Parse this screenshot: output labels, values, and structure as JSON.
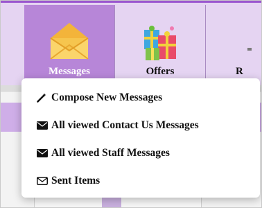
{
  "nav": {
    "tiles": [
      {
        "label": "Messages",
        "icon": "envelope-icon"
      },
      {
        "label": "Offers",
        "icon": "gift-boxes-icon"
      },
      {
        "label": "R",
        "icon": "cut-off-icon"
      }
    ]
  },
  "dropdown": {
    "items": [
      {
        "label": "Compose New Messages",
        "icon": "magic-wand-icon"
      },
      {
        "label": "All viewed Contact Us Messages",
        "icon": "envelope-solid-icon"
      },
      {
        "label": "All viewed Staff Messages",
        "icon": "envelope-solid-icon"
      },
      {
        "label": "Sent Items",
        "icon": "envelope-outline-icon"
      }
    ]
  },
  "colors": {
    "accent": "#9a55cf",
    "active_tile": "#b786d8",
    "tile_bg": "#e5d4f2"
  }
}
